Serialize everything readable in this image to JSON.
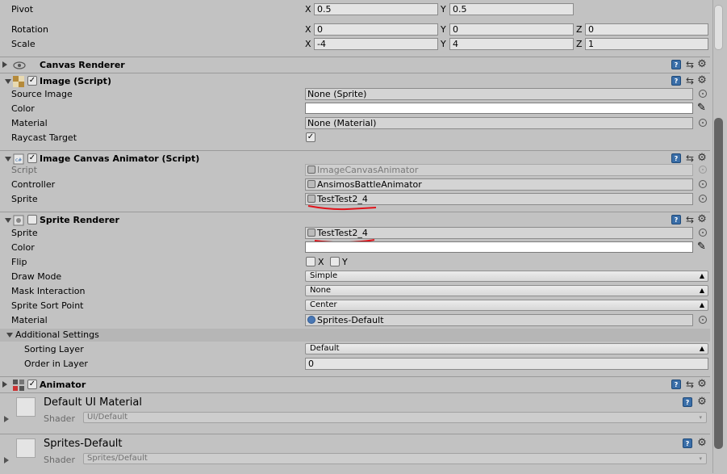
{
  "transform": {
    "pivot": {
      "label": "Pivot",
      "x": "0.5",
      "y": "0.5"
    },
    "rotation": {
      "label": "Rotation",
      "x": "0",
      "y": "0",
      "z": "0"
    },
    "scale": {
      "label": "Scale",
      "x": "-4",
      "y": "4",
      "z": "1"
    },
    "axis_x": "X",
    "axis_y": "Y",
    "axis_z": "Z"
  },
  "canvas_renderer": {
    "title": "Canvas Renderer"
  },
  "image_script": {
    "title": "Image (Script)",
    "source_image": {
      "label": "Source Image",
      "value": "None (Sprite)"
    },
    "color": {
      "label": "Color"
    },
    "material": {
      "label": "Material",
      "value": "None (Material)"
    },
    "raycast_target": {
      "label": "Raycast Target",
      "checked": "✓"
    }
  },
  "image_canvas_animator": {
    "title": "Image Canvas Animator (Script)",
    "script": {
      "label": "Script",
      "value": "ImageCanvasAnimator"
    },
    "controller": {
      "label": "Controller",
      "value": "AnsimosBattleAnimator"
    },
    "sprite": {
      "label": "Sprite",
      "value": "TestTest2_4"
    }
  },
  "sprite_renderer": {
    "title": "Sprite Renderer",
    "sprite": {
      "label": "Sprite",
      "value": "TestTest2_4"
    },
    "color": {
      "label": "Color"
    },
    "flip": {
      "label": "Flip",
      "x": "X",
      "y": "Y"
    },
    "draw_mode": {
      "label": "Draw Mode",
      "value": "Simple"
    },
    "mask_interaction": {
      "label": "Mask Interaction",
      "value": "None"
    },
    "sprite_sort_point": {
      "label": "Sprite Sort Point",
      "value": "Center"
    },
    "material": {
      "label": "Material",
      "value": "Sprites-Default"
    },
    "additional_settings": "Additional Settings",
    "sorting_layer": {
      "label": "Sorting Layer",
      "value": "Default"
    },
    "order_in_layer": {
      "label": "Order in Layer",
      "value": "0"
    }
  },
  "animator": {
    "title": "Animator"
  },
  "materials": [
    {
      "name": "Default UI Material",
      "shader_label": "Shader",
      "shader": "UI/Default"
    },
    {
      "name": "Sprites-Default",
      "shader_label": "Shader",
      "shader": "Sprites/Default"
    }
  ],
  "icons": {
    "check": "✓",
    "dropdown": "▾",
    "picker": "✎",
    "gear": "⚙",
    "preset": "⇆",
    "book": "?"
  },
  "colors": {
    "annotation": "#e0141b",
    "scrollbar": "#646464",
    "panel": "#c2c2c2"
  }
}
